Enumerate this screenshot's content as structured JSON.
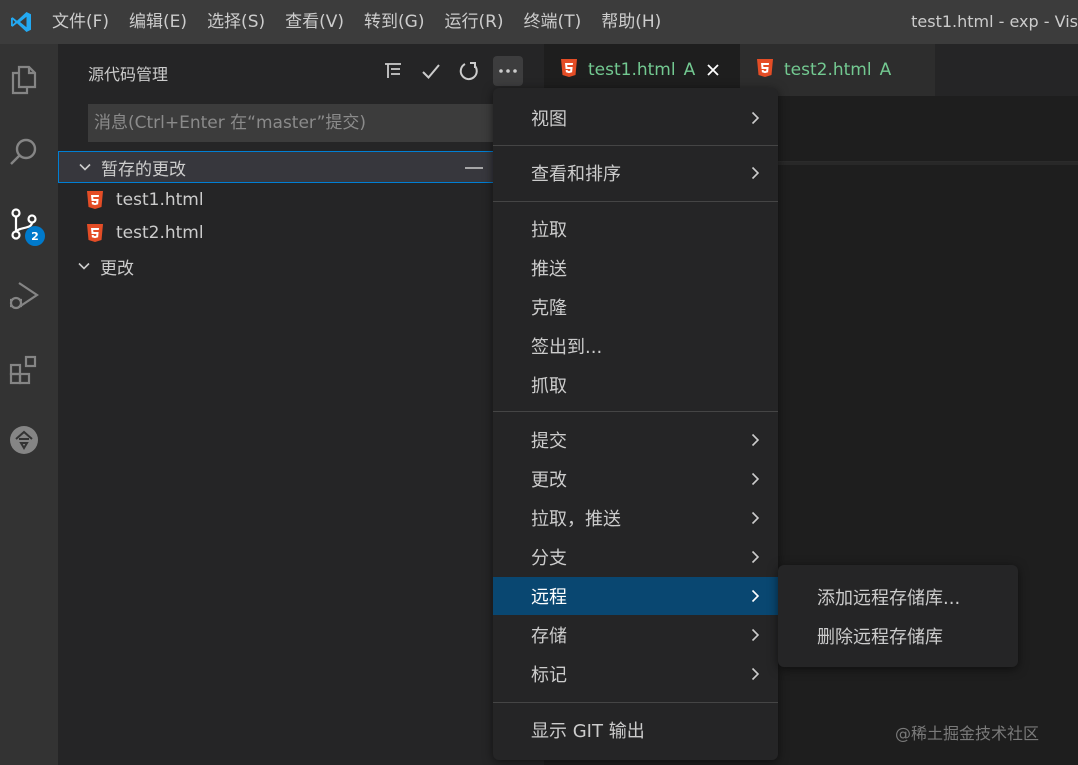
{
  "titlebar": {
    "menu": [
      "文件(F)",
      "编辑(E)",
      "选择(S)",
      "查看(V)",
      "转到(G)",
      "运行(R)",
      "终端(T)",
      "帮助(H)"
    ],
    "window_title": "test1.html - exp - Vis"
  },
  "activitybar": {
    "items": [
      "explorer-icon",
      "search-icon",
      "source-control-icon",
      "run-debug-icon",
      "extensions-icon",
      "account-icon"
    ],
    "scm_badge": "2"
  },
  "sidebar": {
    "title": "源代码管理",
    "actions": [
      "tree-view-icon",
      "check-icon",
      "refresh-icon",
      "more-icon"
    ],
    "commit_placeholder": "消息(Ctrl+Enter 在“master”提交)",
    "staged_group": "暂存的更改",
    "staged_files": [
      "test1.html",
      "test2.html"
    ],
    "changes_group": "更改"
  },
  "tabs": [
    {
      "name": "test1.html",
      "deco": "A"
    },
    {
      "name": "test2.html",
      "deco": "A"
    }
  ],
  "context_menu": {
    "items": [
      {
        "label": "视图",
        "submenu": true
      },
      {
        "label": "查看和排序",
        "submenu": true
      },
      {
        "label": "拉取",
        "submenu": false
      },
      {
        "label": "推送",
        "submenu": false
      },
      {
        "label": "克隆",
        "submenu": false
      },
      {
        "label": "签出到...",
        "submenu": false
      },
      {
        "label": "抓取",
        "submenu": false
      },
      {
        "label": "提交",
        "submenu": true
      },
      {
        "label": "更改",
        "submenu": true
      },
      {
        "label": "拉取，推送",
        "submenu": true
      },
      {
        "label": "分支",
        "submenu": true
      },
      {
        "label": "远程",
        "submenu": true
      },
      {
        "label": "存储",
        "submenu": true
      },
      {
        "label": "标记",
        "submenu": true
      },
      {
        "label": "显示 GIT 输出",
        "submenu": false
      }
    ],
    "highlighted": "远程"
  },
  "submenu": {
    "items": [
      "添加远程存储库...",
      "删除远程存储库"
    ]
  },
  "watermark": "@稀土掘金技术社区",
  "colors": {
    "accent": "#007acc",
    "highlight": "#094771",
    "added": "#73c991",
    "html_icon": "#e44d26"
  }
}
